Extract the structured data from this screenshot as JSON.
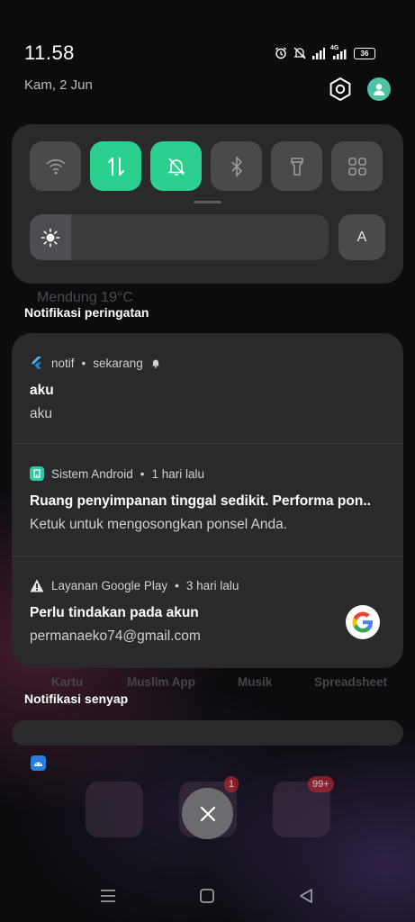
{
  "status_bar": {
    "time": "11.58",
    "date": "Kam, 2 Jun",
    "network": "4G",
    "battery": "36",
    "icons": [
      "alarm-icon",
      "mute-icon",
      "signal-icon",
      "4g-signal-icon",
      "battery-icon"
    ]
  },
  "header_icons": [
    "settings-icon",
    "avatar-icon"
  ],
  "quick_settings": {
    "tiles": [
      {
        "name": "wifi",
        "icon": "wifi-icon",
        "active": false
      },
      {
        "name": "mobile-data",
        "icon": "data-arrows-icon",
        "active": true
      },
      {
        "name": "silent",
        "icon": "bell-off-icon",
        "active": true
      },
      {
        "name": "bluetooth",
        "icon": "bluetooth-icon",
        "active": false
      },
      {
        "name": "flashlight",
        "icon": "flashlight-icon",
        "active": false
      },
      {
        "name": "more",
        "icon": "grid-icon",
        "active": false
      }
    ],
    "brightness_level": 0.14,
    "auto_label": "A",
    "active_color": "#2bd08f"
  },
  "weather_ghost": "Mendung 19°C",
  "alert_section": {
    "title": "Notifikasi peringatan",
    "notifications": [
      {
        "app": "notif",
        "time": "sekarang",
        "title": "aku",
        "body": "aku",
        "icon": "flutter-icon"
      },
      {
        "app": "Sistem Android",
        "time": "1 hari lalu",
        "title": "Ruang penyimpanan tinggal sedikit. Performa pon..",
        "body": "Ketuk untuk mengosongkan ponsel Anda.",
        "icon": "android-system-icon"
      },
      {
        "app": "Layanan Google Play",
        "time": "3 hari lalu",
        "title": "Perlu tindakan pada akun",
        "body": "permanaeko74@gmail.com",
        "icon": "warning-icon"
      }
    ],
    "separator": "•"
  },
  "background_labels": [
    "Kartu",
    "Muslim App",
    "Musik",
    "Spreadsheet"
  ],
  "silent_section": {
    "title": "Notifikasi senyap"
  },
  "folder_badges": [
    "1",
    "99+"
  ],
  "nav": [
    "menu-icon",
    "home-icon",
    "back-icon"
  ]
}
